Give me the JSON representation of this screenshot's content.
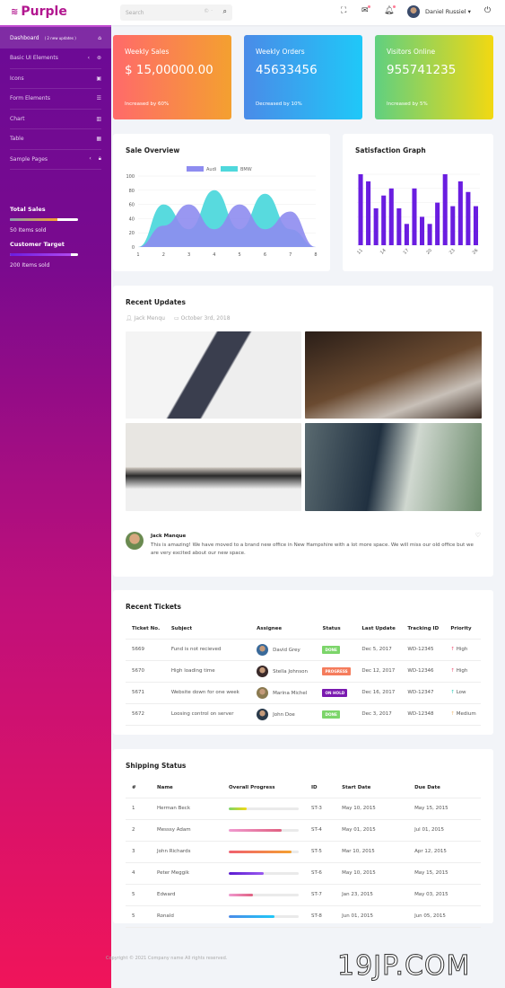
{
  "brand": {
    "name": "Purple",
    "color": "#b2168f"
  },
  "topbar": {
    "search_placeholder": "Search",
    "user_name": "Daniel Russiel ▾",
    "icons": [
      "fullscreen-icon",
      "mail-icon",
      "bell-icon",
      "power-icon"
    ]
  },
  "sidebar": {
    "items": [
      {
        "label": "Dashboard",
        "badge": "( 2 new updates )",
        "icon": "⌂",
        "icon_name": "home-icon",
        "active": true
      },
      {
        "label": "Basic UI Elements",
        "icon": "⊛",
        "icon_name": "crosshairs-icon",
        "chevron": "‹"
      },
      {
        "label": "Icons",
        "icon": "▣",
        "icon_name": "contacts-icon"
      },
      {
        "label": "Form Elements",
        "icon": "☰",
        "icon_name": "format-list-icon"
      },
      {
        "label": "Chart",
        "icon": "▥",
        "icon_name": "chart-bar-icon"
      },
      {
        "label": "Table",
        "icon": "▦",
        "icon_name": "table-icon"
      },
      {
        "label": "Sample Pages",
        "icon": "🔒︎",
        "icon_name": "lock-icon",
        "chevron": "‹"
      }
    ],
    "total_sales": {
      "title": "Total Sales",
      "text": "50 Items sold",
      "progress": 70
    },
    "customer_target": {
      "title": "Customer Target",
      "text": "200 Items sold",
      "progress": 90
    }
  },
  "stats": [
    {
      "title": "Weekly Sales",
      "value": "$ 15,00000.00",
      "sub": "Increased by 60%",
      "gradient": [
        "#ff6a6a",
        "#f4a030"
      ]
    },
    {
      "title": "Weekly Orders",
      "value": "45633456",
      "sub": "Decreased by 10%",
      "gradient": [
        "#4a8be8",
        "#1fc8f8"
      ]
    },
    {
      "title": "Visitors Online",
      "value": "955741235",
      "sub": "Increased by 5%",
      "gradient": [
        "#60d080",
        "#f2d812"
      ]
    }
  ],
  "sale_overview": {
    "title": "Sale Overview"
  },
  "satisfaction": {
    "title": "Satisfaction Graph"
  },
  "chart_data": [
    {
      "type": "area",
      "title": "Sale Overview",
      "x": [
        1,
        2,
        3,
        4,
        5,
        6,
        7,
        8
      ],
      "ylim": [
        0,
        100
      ],
      "yticks": [
        0,
        20,
        40,
        60,
        80,
        100
      ],
      "legend": "top",
      "series": [
        {
          "name": "Audi",
          "color": "#8e8cf0",
          "values": [
            0,
            30,
            60,
            25,
            60,
            25,
            50,
            0
          ]
        },
        {
          "name": "BMW",
          "color": "#4fd8dc",
          "values": [
            0,
            60,
            25,
            80,
            25,
            75,
            25,
            0
          ]
        }
      ]
    },
    {
      "type": "bar",
      "title": "Satisfaction Graph",
      "x": [
        11,
        12,
        13,
        14,
        15,
        16,
        17,
        18,
        19,
        20,
        21,
        22,
        23,
        24,
        25,
        26
      ],
      "xticks": [
        11,
        14,
        17,
        20,
        23,
        26
      ],
      "ylim": [
        0,
        100
      ],
      "color": "#6a1de0",
      "values": [
        100,
        90,
        52,
        70,
        80,
        52,
        30,
        80,
        40,
        30,
        60,
        100,
        55,
        90,
        75,
        55
      ]
    }
  ],
  "updates": {
    "title": "Recent Updates",
    "author": "Jack Menqu",
    "date": "October 3rd, 2018",
    "comment": {
      "name": "Jack Manque",
      "text": "This is amazing! We have moved to a brand new office in New Hampshire with a lot more space. We will miss our old office but we are very excited about our new space."
    }
  },
  "tickets": {
    "title": "Recent Tickets",
    "headers": [
      "Ticket No.",
      "Subject",
      "Assignee",
      "Status",
      "Last Update",
      "Tracking ID",
      "Priority"
    ],
    "rows": [
      {
        "no": "5669",
        "subject": "Fund is not recieved",
        "assignee": "David Grey",
        "status": "DONE",
        "status_color": "#7cd56a",
        "date": "Dec 5, 2017",
        "tracking": "WD-12345",
        "priority": "High",
        "arrow": "↑",
        "arrow_color": "#e57"
      },
      {
        "no": "5670",
        "subject": "High loading time",
        "assignee": "Stella Johnson",
        "status": "PROGRESS",
        "status_color": "#f57c5c",
        "date": "Dec 12, 2017",
        "tracking": "WD-12346",
        "priority": "High",
        "arrow": "↑",
        "arrow_color": "#e57"
      },
      {
        "no": "5671",
        "subject": "Website down for one week",
        "assignee": "Marina Michel",
        "status": "ON HOLD",
        "status_color": "#7a1ab0",
        "date": "Dec 16, 2017",
        "tracking": "WD-12347",
        "priority": "Low",
        "arrow": "↑",
        "arrow_color": "#3cb"
      },
      {
        "no": "5672",
        "subject": "Loosing control on server",
        "assignee": "John Doe",
        "status": "DONE",
        "status_color": "#7cd56a",
        "date": "Dec 3, 2017",
        "tracking": "WD-12348",
        "priority": "Medium",
        "arrow": "↑",
        "arrow_color": "#eb7"
      }
    ]
  },
  "shipping": {
    "title": "Shipping Status",
    "headers": [
      "#",
      "Name",
      "Overall Progress",
      "ID",
      "Start Date",
      "Due Date"
    ],
    "rows": [
      {
        "n": "1",
        "name": "Herman Beck",
        "progress": 25,
        "colors": [
          "#7cd56a",
          "#f2d812"
        ],
        "id": "ST-3",
        "start": "May 10, 2015",
        "due": "May 15, 2015"
      },
      {
        "n": "2",
        "name": "Messsy Adam",
        "progress": 75,
        "colors": [
          "#f09ad0",
          "#e06080"
        ],
        "id": "ST-4",
        "start": "May 01, 2015",
        "due": "Jul 01, 2015"
      },
      {
        "n": "3",
        "name": "John Richards",
        "progress": 90,
        "colors": [
          "#f06070",
          "#f4a030"
        ],
        "id": "ST-5",
        "start": "Mar 10, 2015",
        "due": "Apr 12, 2015"
      },
      {
        "n": "4",
        "name": "Peter Meggik",
        "progress": 50,
        "colors": [
          "#5a1ad0",
          "#9a5af0"
        ],
        "id": "ST-6",
        "start": "May 10, 2015",
        "due": "May 15, 2015"
      },
      {
        "n": "5",
        "name": "Edward",
        "progress": 35,
        "colors": [
          "#f09ad0",
          "#e06080"
        ],
        "id": "ST-7",
        "start": "Jan 23, 2015",
        "due": "May 03, 2015"
      },
      {
        "n": "5",
        "name": "Ronald",
        "progress": 65,
        "colors": [
          "#4a8be8",
          "#1fc8f8"
        ],
        "id": "ST-8",
        "start": "Jun 01, 2015",
        "due": "Jun 05, 2015"
      }
    ]
  },
  "footer": "Copyright © 2021 Company name All rights reserved.",
  "watermark": "19JP.COM"
}
